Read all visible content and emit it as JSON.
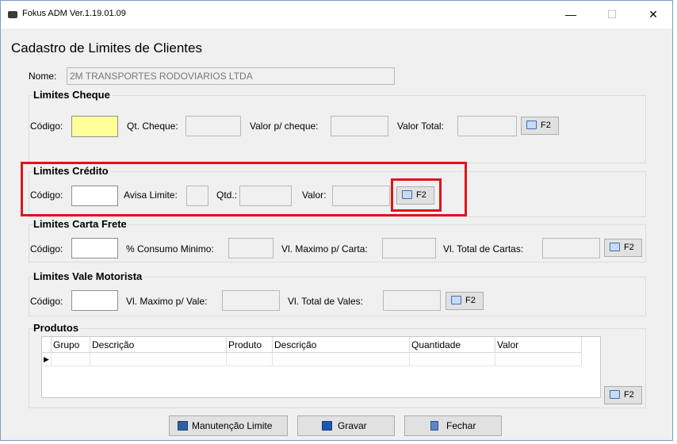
{
  "window": {
    "title": "Fokus ADM Ver.1.19.01.09",
    "minimize": "—",
    "maximize": "☐",
    "close": "✕"
  },
  "form": {
    "heading": "Cadastro de Limites de Clientes",
    "nome_label": "Nome:",
    "nome_value": "2M TRANSPORTES RODOVIARIOS LTDA"
  },
  "cheque": {
    "title": "Limites Cheque",
    "codigo_label": "Código:",
    "qt_label": "Qt. Cheque:",
    "valor_label": "Valor p/ cheque:",
    "total_label": "Valor Total:",
    "button": "F2"
  },
  "credito": {
    "title": "Limites Crédito",
    "codigo_label": "Código:",
    "avisa_label": "Avisa Limite:",
    "qtd_label": "Qtd.:",
    "valor_label": "Valor:",
    "button": "F2"
  },
  "carta": {
    "title": "Limites Carta Frete",
    "codigo_label": "Código:",
    "consumo_label": "% Consumo Minimo:",
    "max_label": "Vl. Maximo p/ Carta:",
    "total_label": "Vl. Total de Cartas:",
    "button": "F2"
  },
  "vale": {
    "title": "Limites Vale Motorista",
    "codigo_label": "Código:",
    "max_label": "Vl. Maximo p/ Vale:",
    "total_label": "Vl. Total de Vales:",
    "button": "F2"
  },
  "produtos": {
    "title": "Produtos",
    "columns": [
      "Grupo",
      "Descrição",
      "Produto",
      "Descrição",
      "Quantidade",
      "Valor"
    ],
    "row_indicator": "▶",
    "button": "F2"
  },
  "footer": {
    "manutencao": "Manutenção Limite",
    "gravar": "Gravar",
    "fechar": "Fechar"
  },
  "colors": {
    "highlight": "#e0141a",
    "required_field": "#ffff99"
  }
}
